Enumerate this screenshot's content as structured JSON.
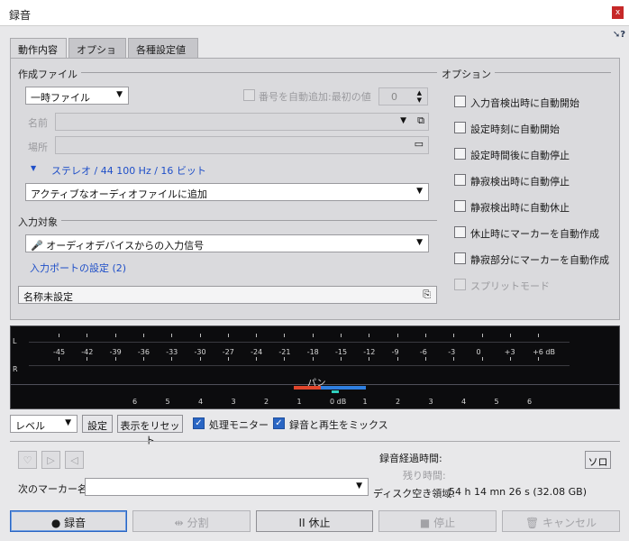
{
  "window": {
    "title": "録音",
    "close_label": "x",
    "help_label": "?"
  },
  "tabs": [
    "動作内容",
    "オプション",
    "各種設定値"
  ],
  "create_file": {
    "group_label": "作成ファイル",
    "file_type": "一時ファイル",
    "auto_number_label": "番号を自動追加:最初の値",
    "auto_number_value": "0",
    "name_label": "名前",
    "location_label": "場所",
    "format_link": "ステレオ / 44 100 Hz / 16 ビット",
    "add_mode": "アクティブなオーディオファイルに追加"
  },
  "input": {
    "group_label": "入力対象",
    "source": "オーディオデバイスからの入力信号",
    "port_link": "入力ポートの設定 (2)"
  },
  "marker_field": {
    "value": "名称未設定"
  },
  "options": {
    "group_label": "オプション",
    "items": [
      {
        "label": "入力音検出時に自動開始",
        "disabled": false
      },
      {
        "label": "設定時刻に自動開始",
        "disabled": false
      },
      {
        "label": "設定時間後に自動停止",
        "disabled": false
      },
      {
        "label": "静寂検出時に自動停止",
        "disabled": false
      },
      {
        "label": "静寂検出時に自動休止",
        "disabled": false
      },
      {
        "label": "休止時にマーカーを自動作成",
        "disabled": false
      },
      {
        "label": "静寂部分にマーカーを自動作成",
        "disabled": false
      },
      {
        "label": "スプリットモード",
        "disabled": true
      }
    ]
  },
  "meter": {
    "channel_l": "L",
    "channel_r": "R",
    "scale": [
      "-45",
      "-42",
      "-39",
      "-36",
      "-33",
      "-30",
      "-27",
      "-24",
      "-21",
      "-18",
      "-15",
      "-12",
      "-9",
      "-6",
      "-3",
      "0",
      "+3",
      "+6 dB"
    ],
    "pan_label": "パン",
    "pan_scale": [
      "6",
      "5",
      "4",
      "3",
      "2",
      "1",
      "0 dB",
      "1",
      "2",
      "3",
      "4",
      "5",
      "6"
    ],
    "colors": {
      "pan_left": "#e0462c",
      "pan_right": "#2f7fe0",
      "pan_center": "#2fd0c0"
    }
  },
  "controls": {
    "display_mode": "レベル",
    "settings_label": "設定",
    "reset_label": "表示をリセット",
    "monitor_label": "処理モニター",
    "mix_label": "録音と再生をミックス"
  },
  "status": {
    "elapsed_label": "録音経過時間:",
    "remaining_label": "残り時間:",
    "disk_label": "ディスク空き領域:",
    "disk_value": "54 h 14 mn 26 s (32.08 GB)",
    "solo_label": "ソロ",
    "next_marker_label": "次のマーカー名"
  },
  "actions": {
    "record": "● 録音",
    "split": "分割",
    "pause": "II 休止",
    "stop": "■ 停止",
    "cancel": "キャンセル"
  }
}
